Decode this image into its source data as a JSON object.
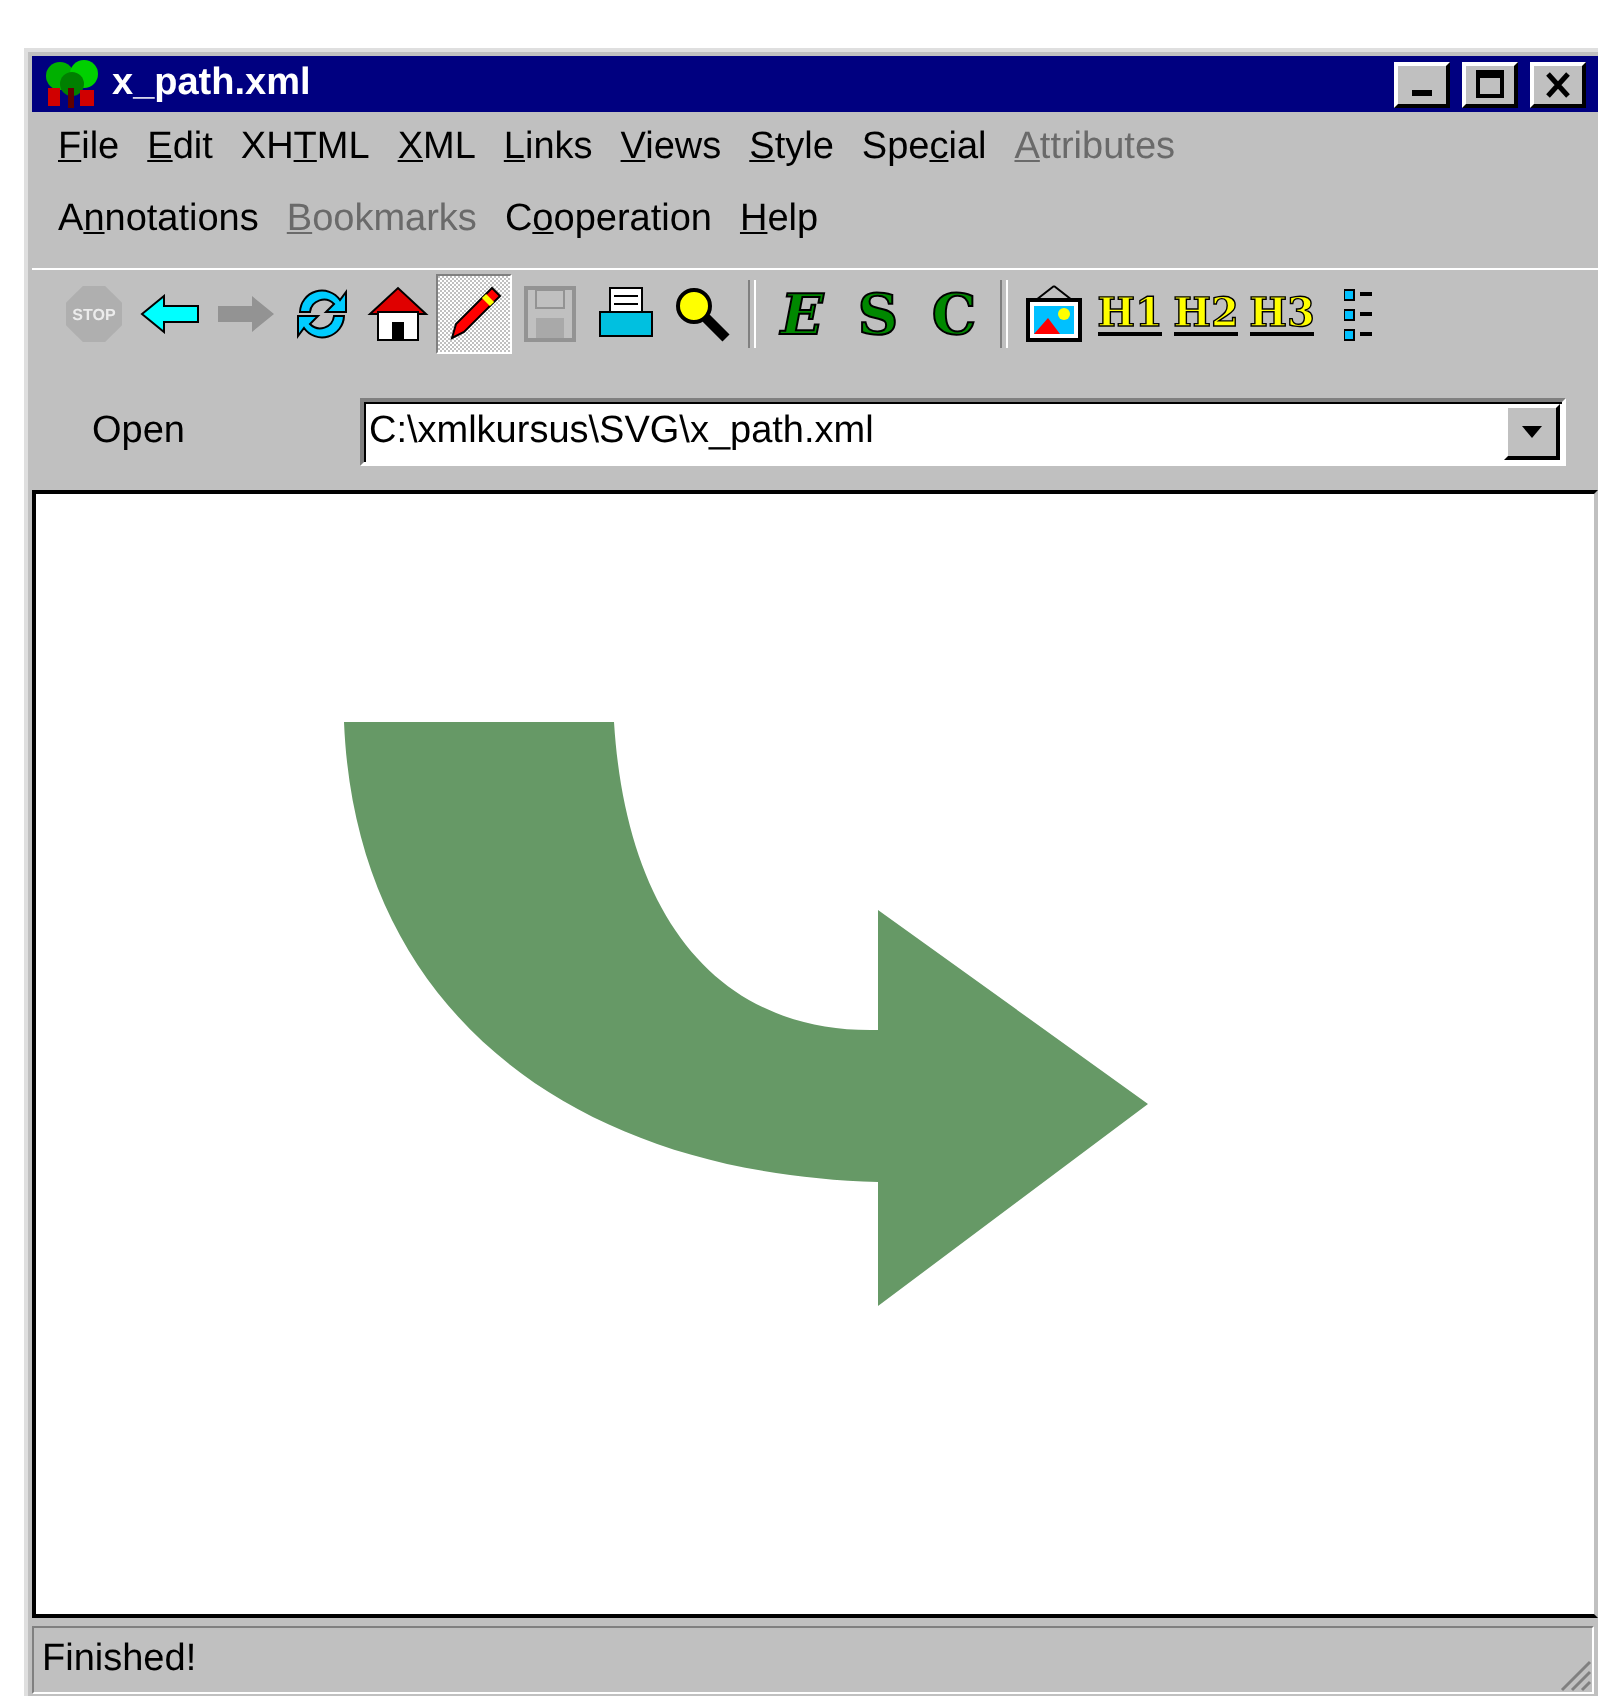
{
  "window": {
    "title": "x_path.xml"
  },
  "menu_rows": [
    [
      {
        "key": "F",
        "after": "ile",
        "disabled": false
      },
      {
        "key": "E",
        "after": "dit",
        "disabled": false
      },
      {
        "before": "XH",
        "key": "T",
        "after": "ML",
        "disabled": false
      },
      {
        "key": "X",
        "after": "ML",
        "disabled": false
      },
      {
        "key": "L",
        "after": "inks",
        "disabled": false
      },
      {
        "key": "V",
        "after": "iews",
        "disabled": false
      },
      {
        "key": "S",
        "after": "tyle",
        "disabled": false
      },
      {
        "before": "Spe",
        "key": "c",
        "after": "ial",
        "disabled": false
      },
      {
        "key": "A",
        "after": "ttributes",
        "disabled": true
      }
    ],
    [
      {
        "before": "A",
        "key": "n",
        "after": "notations",
        "disabled": false
      },
      {
        "key": "B",
        "after": "ookmarks",
        "disabled": true
      },
      {
        "before": "C",
        "key": "o",
        "after": "operation",
        "disabled": false
      },
      {
        "key": "H",
        "after": "elp",
        "disabled": false
      }
    ]
  ],
  "toolbar": [
    [
      {
        "kind": "stop",
        "label": "STOP",
        "pressed": false,
        "disabled": true
      },
      {
        "kind": "back",
        "pressed": false,
        "disabled": false
      },
      {
        "kind": "forward",
        "pressed": false,
        "disabled": true
      },
      {
        "kind": "reload",
        "pressed": false,
        "disabled": false
      },
      {
        "kind": "home",
        "pressed": false,
        "disabled": false
      },
      {
        "kind": "edit",
        "pressed": true,
        "disabled": false
      },
      {
        "kind": "save",
        "pressed": false,
        "disabled": true
      },
      {
        "kind": "print",
        "pressed": false,
        "disabled": false
      },
      {
        "kind": "find",
        "pressed": false,
        "disabled": false
      }
    ],
    [
      {
        "kind": "letter",
        "label": "E",
        "color": "#008800",
        "italic": true,
        "pressed": false,
        "disabled": false
      },
      {
        "kind": "letter",
        "label": "S",
        "color": "#008800",
        "italic": false,
        "pressed": false,
        "disabled": false
      },
      {
        "kind": "letter",
        "label": "C",
        "color": "#008800",
        "italic": false,
        "pressed": false,
        "disabled": false
      }
    ],
    [
      {
        "kind": "image",
        "pressed": false,
        "disabled": false
      },
      {
        "kind": "heading",
        "label": "H1",
        "color": "#ffff00",
        "pressed": false,
        "disabled": false
      },
      {
        "kind": "heading",
        "label": "H2",
        "color": "#ffff00",
        "pressed": false,
        "disabled": false
      },
      {
        "kind": "heading",
        "label": "H3",
        "color": "#ffff00",
        "pressed": false,
        "disabled": false
      },
      {
        "kind": "list",
        "pressed": false,
        "disabled": false
      }
    ]
  ],
  "address": {
    "label": "Open",
    "value": "C:\\xmlkursus\\SVG\\x_path.xml"
  },
  "status_bar": "Finished!"
}
